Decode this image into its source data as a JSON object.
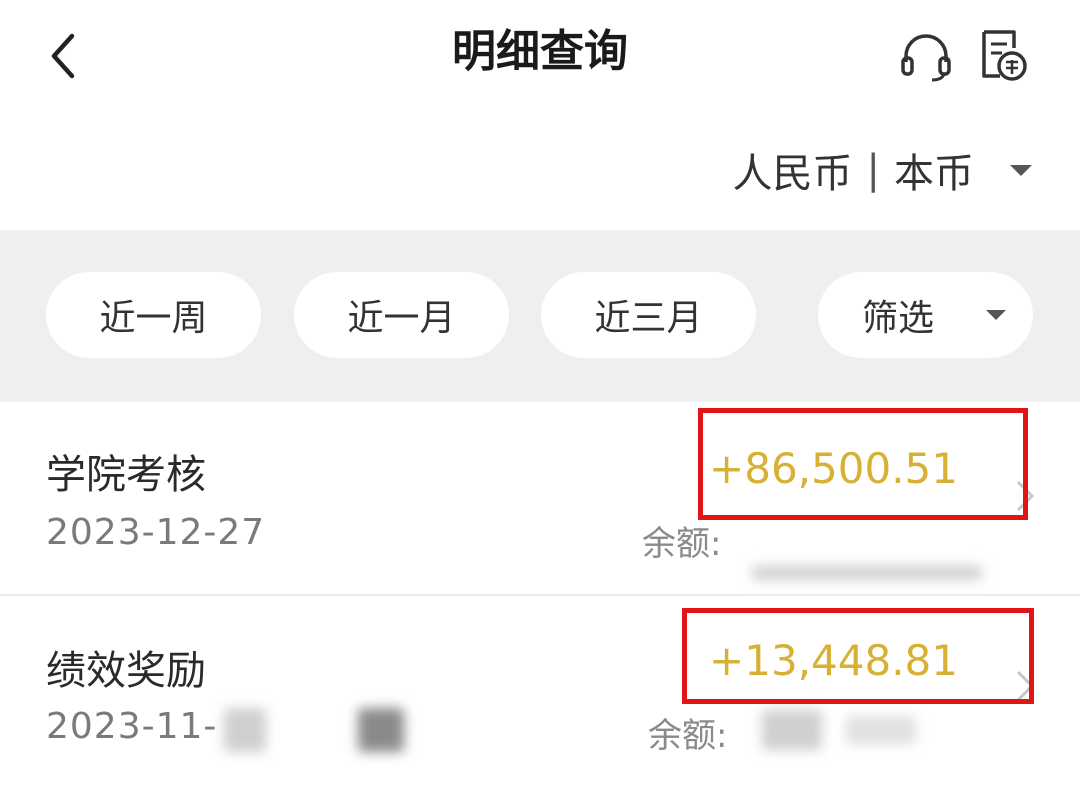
{
  "header": {
    "title": "明细查询",
    "back_icon": "chevron-left-icon",
    "customer_service_icon": "headset-icon",
    "export_icon": "export-document-icon"
  },
  "currency": {
    "label": "人民币",
    "separator": "|",
    "sub_label": "本币"
  },
  "filters": {
    "week": "近一周",
    "month": "近一月",
    "three_months": "近三月",
    "filter": "筛选"
  },
  "transactions": [
    {
      "title": "学院考核",
      "date": "2023-12-27",
      "amount": "+86,500.51",
      "balance_label": "余额:"
    },
    {
      "title": "绩效奖励",
      "date": "2023-11-",
      "amount": "+13,448.81",
      "balance_label": "余额:"
    }
  ],
  "colors": {
    "amount": "#d8b033",
    "highlight": "#e01515",
    "filter_bg": "#efefef"
  }
}
